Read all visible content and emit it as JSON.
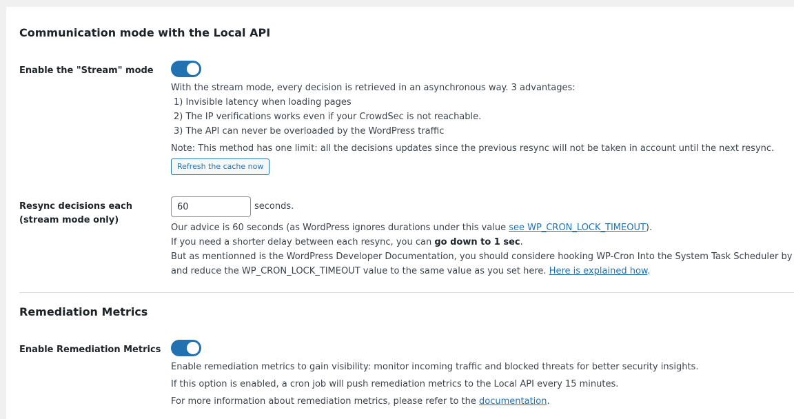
{
  "stream_section": {
    "title": "Communication mode with the Local API",
    "stream_label": "Enable the \"Stream\" mode",
    "stream_enabled": true,
    "stream_desc": {
      "intro": "With the stream mode, every decision is retrieved in an asynchronous way. 3 advantages:",
      "adv1": "1) Invisible latency when loading pages",
      "adv2": "2) The IP verifications works even if your CrowdSec is not reachable.",
      "adv3": "3) The API can never be overloaded by the WordPress traffic",
      "note": "Note: This method has one limit: all the decisions updates since the previous resync will not be taken in account until the next resync."
    },
    "refresh_button": "Refresh the cache now",
    "resync_label_line1": "Resync decisions each",
    "resync_label_line2": "(stream mode only)",
    "resync_value": "60",
    "resync_unit": "seconds.",
    "resync_desc": {
      "advice_prefix": "Our advice is 60 seconds (as WordPress ignores durations under this value ",
      "advice_link": "see WP_CRON_LOCK_TIMEOUT",
      "advice_suffix": ").",
      "shorter_prefix": "If you need a shorter delay between each resync, you can ",
      "shorter_bold": "go down to 1 sec",
      "shorter_suffix": ".",
      "docs_line": "But as mentionned is the WordPress Developer Documentation, you should considere hooking WP-Cron Into the System Task Scheduler by yourself",
      "reduce_prefix": "and reduce the WP_CRON_LOCK_TIMEOUT value to the same value as you set here. ",
      "reduce_link": "Here is explained how",
      "reduce_suffix": "."
    }
  },
  "metrics_section": {
    "title": "Remediation Metrics",
    "metrics_label": "Enable Remediation Metrics",
    "metrics_enabled": true,
    "desc1": "Enable remediation metrics to gain visibility: monitor incoming traffic and blocked threats for better security insights.",
    "desc2": "If this option is enabled, a cron job will push remediation metrics to the Local API every 15 minutes.",
    "desc3_prefix": "For more information about remediation metrics, please refer to the ",
    "desc3_link": "documentation",
    "desc3_suffix": "."
  },
  "colors": {
    "accent": "#2271b1",
    "background": "#f0f0f1",
    "panel": "#ffffff"
  }
}
